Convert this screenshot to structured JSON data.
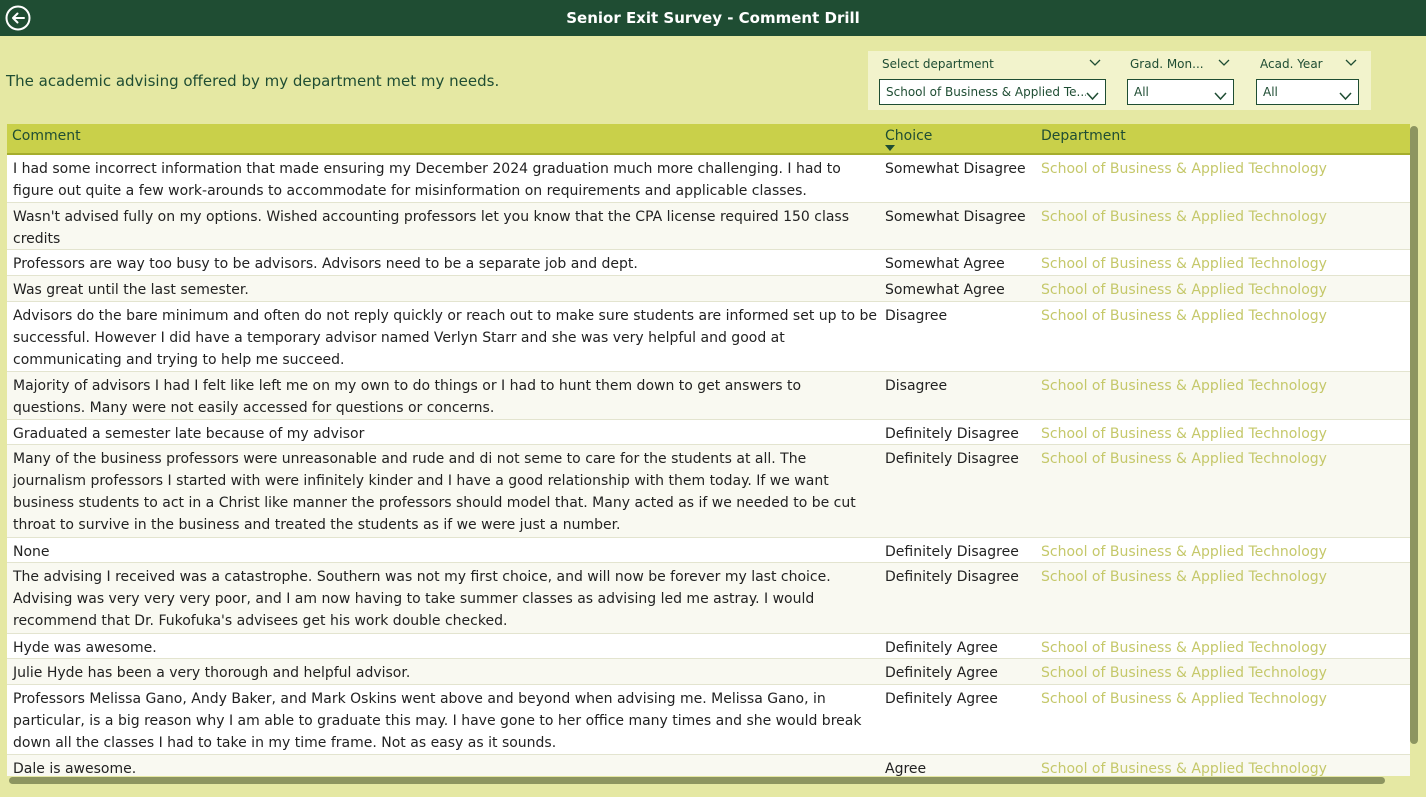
{
  "header": {
    "title": "Senior Exit Survey - Comment Drill"
  },
  "question": "The academic advising offered by my department met my needs.",
  "filters": {
    "department": {
      "label": "Select department",
      "value": "School of Business & Applied Te..."
    },
    "grad_month": {
      "label": "Grad. Mon...",
      "value": "All"
    },
    "acad_year": {
      "label": "Acad. Year",
      "value": "All"
    }
  },
  "table": {
    "columns": {
      "comment": "Comment",
      "choice": "Choice",
      "department": "Department"
    },
    "rows": [
      {
        "comment": "I had some incorrect information that made ensuring my December 2024 graduation much more challenging. I had to figure out quite a few work-arounds to accommodate for misinformation on requirements and applicable classes.",
        "choice": "Somewhat Disagree",
        "department": "School of Business & Applied Technology"
      },
      {
        "comment": "Wasn't advised fully on my options. Wished accounting professors let you know that the CPA license required 150 class credits",
        "choice": "Somewhat Disagree",
        "department": "School of Business & Applied Technology"
      },
      {
        "comment": "Professors are way too busy to be advisors. Advisors need to be a separate job and dept.",
        "choice": "Somewhat Agree",
        "department": "School of Business & Applied Technology"
      },
      {
        "comment": "Was great until the last semester.",
        "choice": "Somewhat Agree",
        "department": "School of Business & Applied Technology"
      },
      {
        "comment": "Advisors do the bare minimum and often do not reply quickly or reach out to make sure students are informed set up to be successful. However I did have a temporary advisor named Verlyn Starr and she was very helpful and good at communicating and trying to help me succeed.",
        "choice": "Disagree",
        "department": "School of Business & Applied Technology"
      },
      {
        "comment": "Majority of advisors I had I felt like left me on my own to do things or I had to hunt them down to get answers to questions. Many were not easily accessed for questions or concerns.",
        "choice": "Disagree",
        "department": "School of Business & Applied Technology"
      },
      {
        "comment": "Graduated a semester late because of my advisor",
        "choice": "Definitely Disagree",
        "department": "School of Business & Applied Technology"
      },
      {
        "comment": "Many of the business professors were unreasonable and rude and di not seme to care for the students at all. The journalism professors I started with were infinitely kinder and I have a good relationship with them today. If we want business students to act in a Christ like manner the professors should model that. Many acted as if we needed to be cut throat to survive in the business and treated the students as if we were just a number.",
        "choice": "Definitely Disagree",
        "department": "School of Business & Applied Technology"
      },
      {
        "comment": "None",
        "choice": "Definitely Disagree",
        "department": "School of Business & Applied Technology"
      },
      {
        "comment": "The advising I received was a catastrophe. Southern was not my first choice, and will now be forever my last choice. Advising was very very very poor, and I am now having to take summer classes as advising led me astray. I would recommend that Dr. Fukofuka's advisees get his work double checked.",
        "choice": "Definitely Disagree",
        "department": "School of Business & Applied Technology"
      },
      {
        "comment": "Hyde was awesome.",
        "choice": "Definitely Agree",
        "department": "School of Business & Applied Technology"
      },
      {
        "comment": "Julie Hyde has been a very thorough and helpful advisor.",
        "choice": "Definitely Agree",
        "department": "School of Business & Applied Technology"
      },
      {
        "comment": "Professors Melissa Gano, Andy Baker, and Mark Oskins went above and beyond when advising me. Melissa Gano, in particular, is a big reason why I am able to graduate this may. I have gone to her office many times and she would break down all the classes I had to take in my time frame. Not as easy as it sounds.",
        "choice": "Definitely Agree",
        "department": "School of Business & Applied Technology"
      },
      {
        "comment": "Dale is awesome.",
        "choice": "Agree",
        "department": "School of Business & Applied Technology"
      }
    ]
  },
  "icons": {
    "back": "back-arrow-icon",
    "dropdown": "chevron-down-icon",
    "sort": "sort-descending-icon"
  },
  "colors": {
    "header_bg": "#1f4d33",
    "page_bg": "#e5e8a3",
    "table_header_bg": "#c9d04a",
    "department_text": "#c5c86a"
  }
}
